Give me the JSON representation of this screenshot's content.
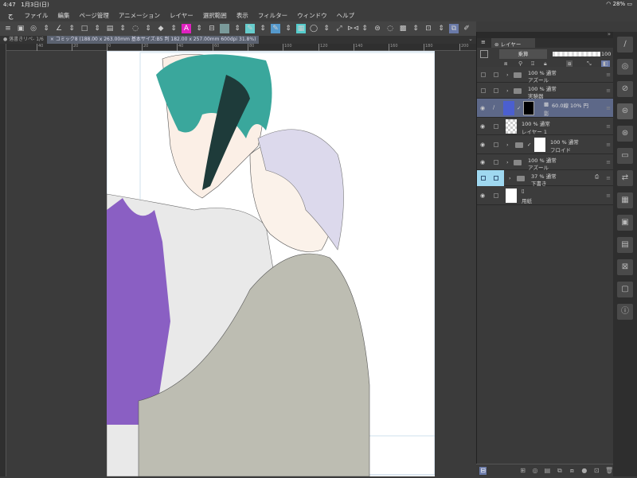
{
  "status": {
    "time": "4:47",
    "date": "1月3日(日)",
    "battery": "28%"
  },
  "menu": [
    "ファイル",
    "編集",
    "ページ管理",
    "アニメーション",
    "レイヤー",
    "選択範囲",
    "表示",
    "フィルター",
    "ウィンドウ",
    "ヘルプ"
  ],
  "tabs": [
    {
      "label": "● 落書きリペ- 1/6"
    },
    {
      "label": "× コミック8 (188.00 x 263.00mm 基本サイズ:B5 判 182.00 x 257.00mm 600dpi 31.8%)"
    }
  ],
  "ruler": [
    "40",
    "20",
    "0",
    "20",
    "40",
    "60",
    "80",
    "100",
    "120",
    "140",
    "160",
    "180",
    "200"
  ],
  "panel": {
    "title": "レイヤー",
    "blend_mode": "乗算",
    "opacity": "100"
  },
  "layers": [
    {
      "line1": "100 % 通常",
      "line2": "アズール",
      "visible": false,
      "type": "folder"
    },
    {
      "line1": "100 % 通常",
      "line2": "実験器",
      "visible": false,
      "type": "folder"
    },
    {
      "line1": "60.0線 10% 円",
      "line2": "影",
      "visible": true,
      "type": "raster",
      "selected": true
    },
    {
      "line1": "100 % 通常",
      "line2": "レイヤー 1",
      "visible": true,
      "type": "raster"
    },
    {
      "line1": "100 % 通常",
      "line2": "フロイド",
      "visible": true,
      "type": "folder"
    },
    {
      "line1": "100 % 通常",
      "line2": "アズール",
      "visible": true,
      "type": "folder"
    },
    {
      "line1": "37 % 通常",
      "line2": "下書き",
      "visible": false,
      "type": "folder"
    },
    {
      "line1": "",
      "line2": "用紙",
      "visible": true,
      "type": "paper"
    }
  ],
  "colors": {
    "accent": "#6a7aa8",
    "selected_layer": "#5d6888",
    "draft_highlight": "#9fd8f0"
  }
}
